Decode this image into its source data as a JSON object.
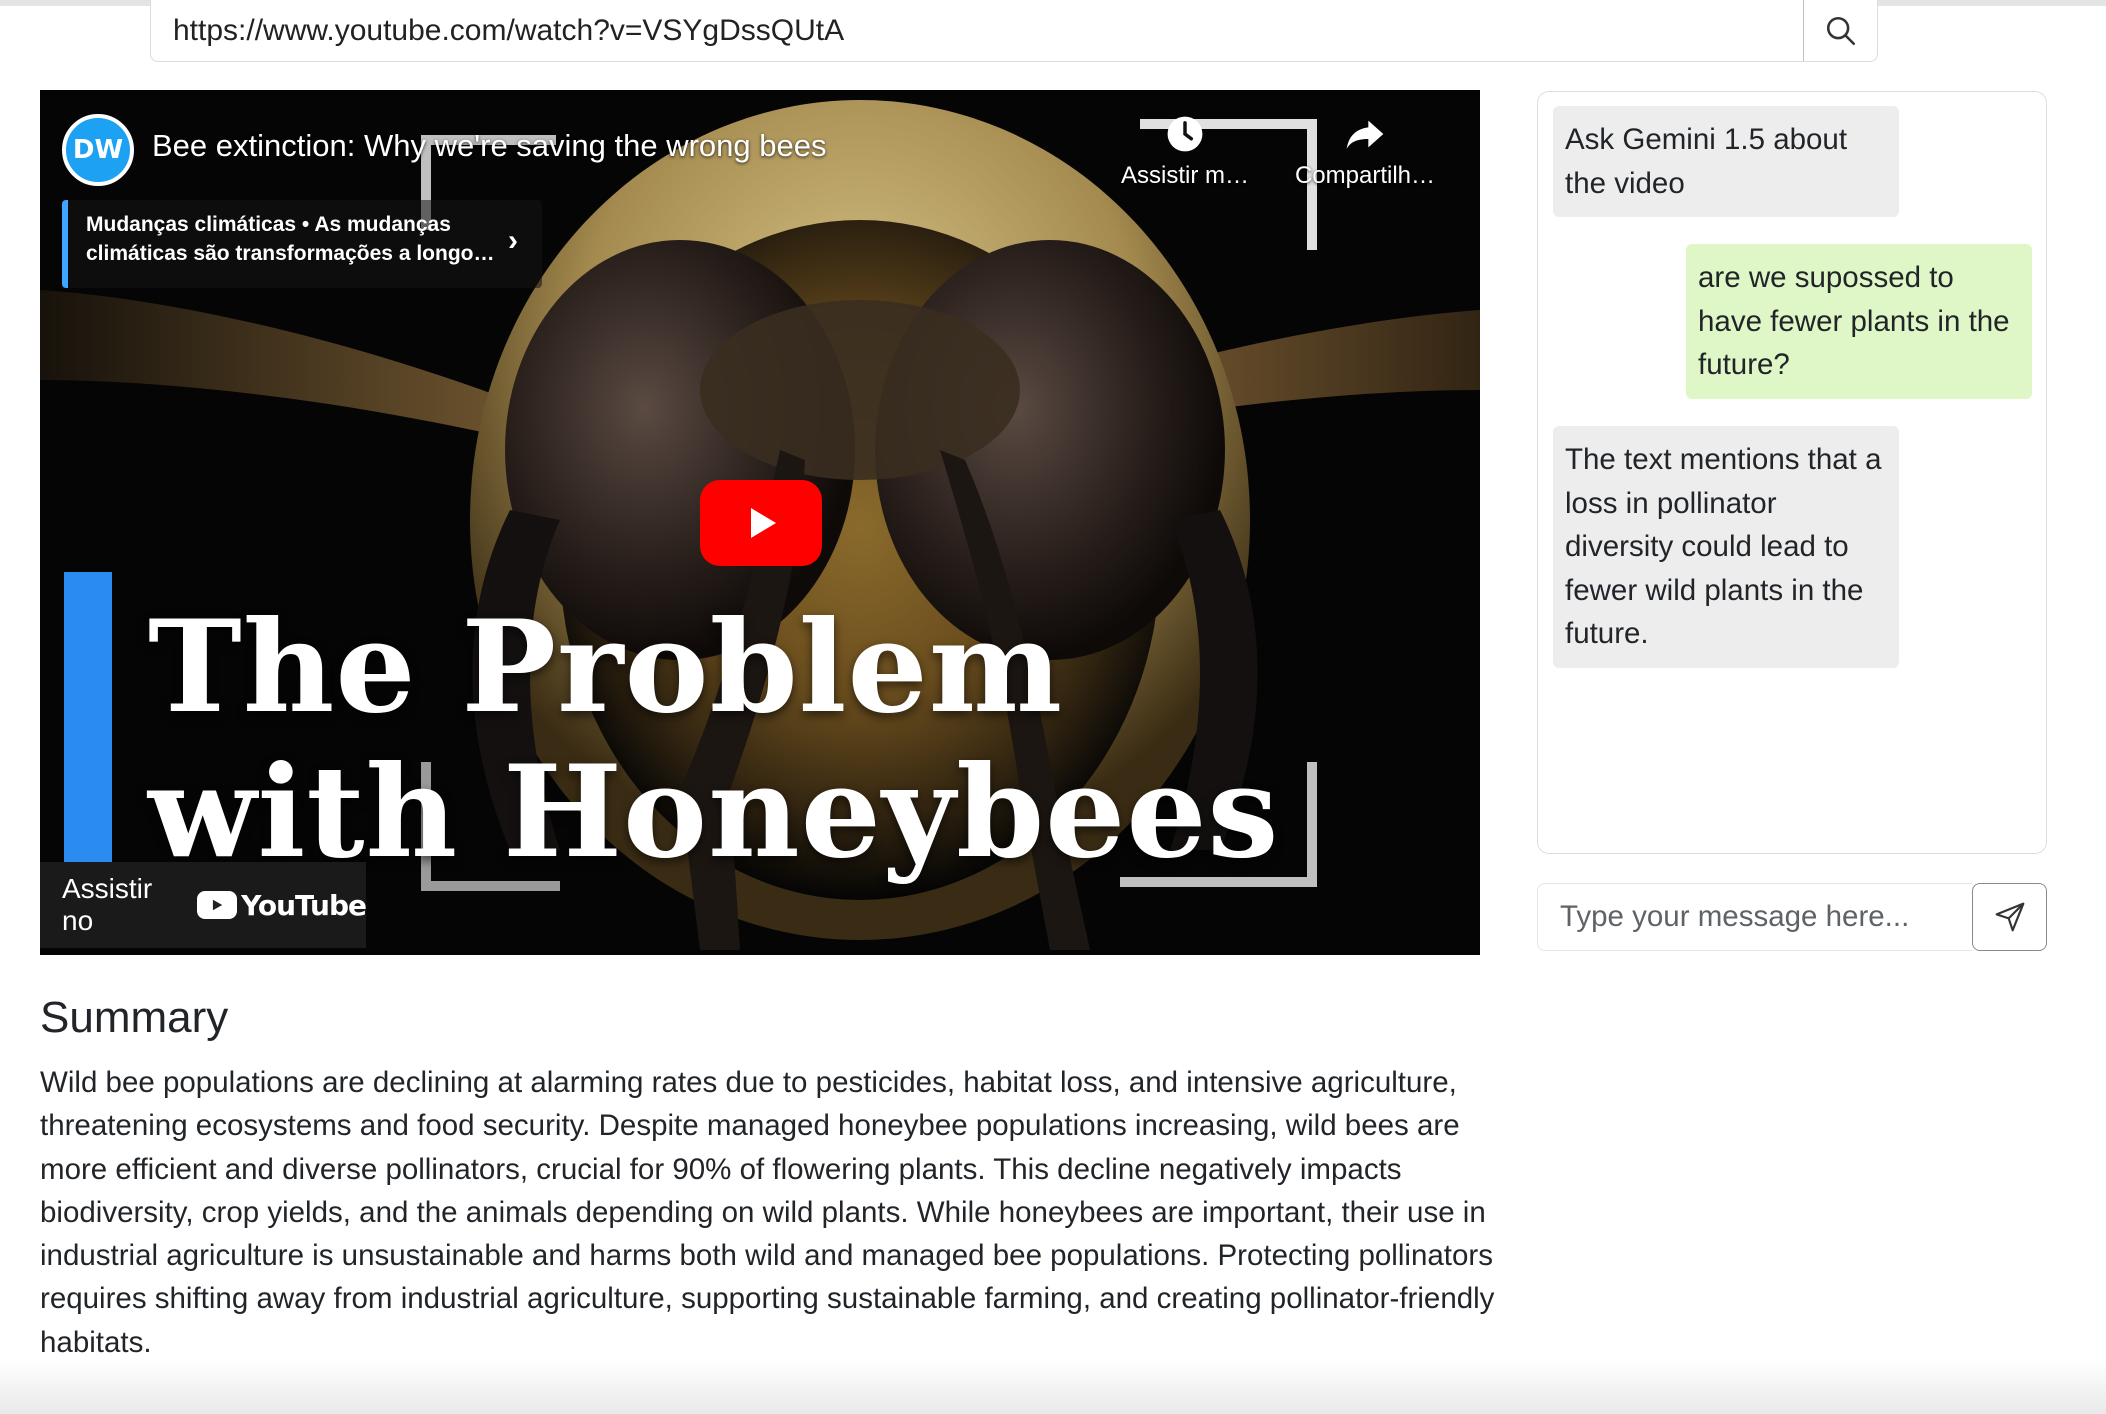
{
  "url_bar": {
    "value": "https://www.youtube.com/watch?v=VSYgDssQUtA",
    "search_icon": "search-icon"
  },
  "video": {
    "channel_logo_text": "DW",
    "title": "Bee extinction: Why we're saving the wrong bees",
    "chip_text": "Mudanças climáticas • As mudanças climáticas são transformações a longo…",
    "watch_later_label": "Assistir m…",
    "share_label": "Compartilh…",
    "thumbnail_title_line1": "The Problem",
    "thumbnail_title_line2": "with Honeybees",
    "watch_on_label": "Assistir no",
    "youtube_logo_text": "YouTube",
    "play_button_color": "#ff0000",
    "accent_blue": "#2a8cf0"
  },
  "summary": {
    "heading": "Summary",
    "text": "Wild bee populations are declining at alarming rates due to pesticides, habitat loss, and intensive agriculture, threatening ecosystems and food security. Despite managed honeybee populations increasing, wild bees are more efficient and diverse pollinators, crucial for 90% of flowering plants. This decline negatively impacts biodiversity, crop yields, and the animals depending on wild plants. While honeybees are important, their use in industrial agriculture is unsustainable and harms both wild and managed bee populations. Protecting pollinators requires shifting away from industrial agriculture, supporting sustainable farming, and creating pollinator-friendly habitats."
  },
  "chat": {
    "messages": [
      {
        "role": "bot",
        "text": "Ask Gemini 1.5 about the video"
      },
      {
        "role": "user",
        "text": "are we supossed to have fewer plants in the future?"
      },
      {
        "role": "bot",
        "text": "The text mentions that a loss in pollinator diversity could lead to fewer wild plants in the future."
      }
    ],
    "input_placeholder": "Type your message here...",
    "send_icon": "send-icon",
    "user_bubble_color": "#dff7c7",
    "bot_bubble_color": "#ededed"
  }
}
